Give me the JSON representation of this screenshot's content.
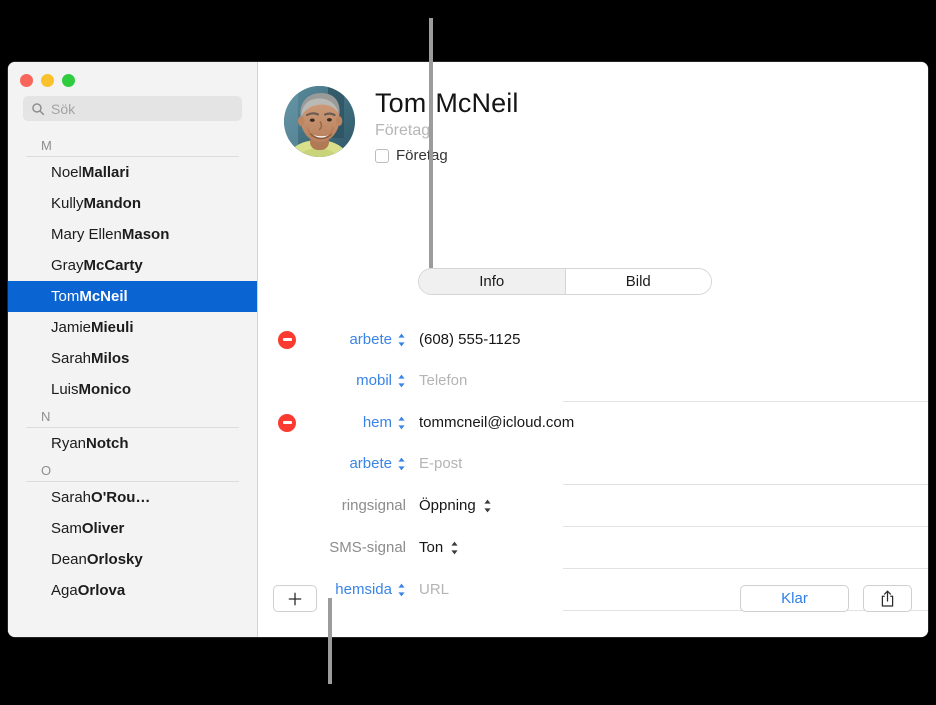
{
  "window": {
    "traffic_lights": {
      "close_color": "#f9655b",
      "minimize_color": "#f9c22c",
      "zoom_color": "#30cc3f"
    }
  },
  "sidebar": {
    "search": {
      "icon": "search-icon",
      "placeholder": "Sök",
      "value": ""
    },
    "sections": [
      {
        "letter": "M",
        "contacts": [
          {
            "given": "Noel ",
            "family": "Mallari",
            "selected": false
          },
          {
            "given": "Kully ",
            "family": "Mandon",
            "selected": false
          },
          {
            "given": "Mary Ellen ",
            "family": "Mason",
            "selected": false
          },
          {
            "given": "Gray ",
            "family": "McCarty",
            "selected": false
          },
          {
            "given": "Tom ",
            "family": "McNeil",
            "selected": true
          },
          {
            "given": "Jamie ",
            "family": "Mieuli",
            "selected": false
          },
          {
            "given": "Sarah ",
            "family": "Milos",
            "selected": false
          },
          {
            "given": "Luis ",
            "family": "Monico",
            "selected": false
          }
        ]
      },
      {
        "letter": "N",
        "contacts": [
          {
            "given": "Ryan ",
            "family": "Notch",
            "selected": false
          }
        ]
      },
      {
        "letter": "O",
        "contacts": [
          {
            "given": "Sarah ",
            "family": "O'Rou…",
            "selected": false
          },
          {
            "given": "Sam ",
            "family": "Oliver",
            "selected": false
          },
          {
            "given": "Dean ",
            "family": "Orlosky",
            "selected": false
          },
          {
            "given": "Aga ",
            "family": "Orlova",
            "selected": false
          }
        ]
      }
    ],
    "selection_color": "#0a64d2"
  },
  "detail": {
    "avatar": {
      "icon": "contact-photo-avatar"
    },
    "name_first": "Tom",
    "name_last": "McNeil",
    "company_placeholder": "Företag",
    "company_checkbox_label": "Företag",
    "company_checked": false,
    "tabs": [
      {
        "label": "Info",
        "active": true
      },
      {
        "label": "Bild",
        "active": false
      }
    ],
    "fields": [
      {
        "has_remove": true,
        "remove_icon": "remove-field-icon",
        "label": "arbete",
        "label_style": "link",
        "has_label_stepper": true,
        "value": "(608) 555-1125",
        "is_placeholder": false,
        "has_value_stepper": false,
        "separator_after": false
      },
      {
        "has_remove": false,
        "label": "mobil",
        "label_style": "link",
        "has_label_stepper": true,
        "value": "Telefon",
        "is_placeholder": true,
        "has_value_stepper": false,
        "separator_after": true
      },
      {
        "has_remove": true,
        "remove_icon": "remove-field-icon",
        "label": "hem",
        "label_style": "link",
        "has_label_stepper": true,
        "value": "tommcneil@icloud.com",
        "is_placeholder": false,
        "has_value_stepper": false,
        "separator_after": false
      },
      {
        "has_remove": false,
        "label": "arbete",
        "label_style": "link",
        "has_label_stepper": true,
        "value": "E-post",
        "is_placeholder": true,
        "has_value_stepper": false,
        "separator_after": true
      },
      {
        "has_remove": false,
        "label": "ringsignal",
        "label_style": "plain",
        "has_label_stepper": false,
        "value": "Öppning",
        "is_placeholder": false,
        "has_value_stepper": true,
        "separator_after": true
      },
      {
        "has_remove": false,
        "label": "SMS-signal",
        "label_style": "plain",
        "has_label_stepper": false,
        "value": "Ton",
        "is_placeholder": false,
        "has_value_stepper": true,
        "separator_after": true
      },
      {
        "has_remove": false,
        "label": "hemsida",
        "label_style": "link",
        "has_label_stepper": true,
        "value": "URL",
        "is_placeholder": true,
        "has_value_stepper": false,
        "separator_after": true
      }
    ],
    "bottom_bar": {
      "add_icon": "plus-icon",
      "done_label": "Klar",
      "share_icon": "share-icon"
    }
  },
  "callouts": [
    {
      "name": "callout-line-top",
      "color": "#9c9c9c"
    },
    {
      "name": "callout-line-bottom",
      "color": "#9c9c9c"
    }
  ]
}
